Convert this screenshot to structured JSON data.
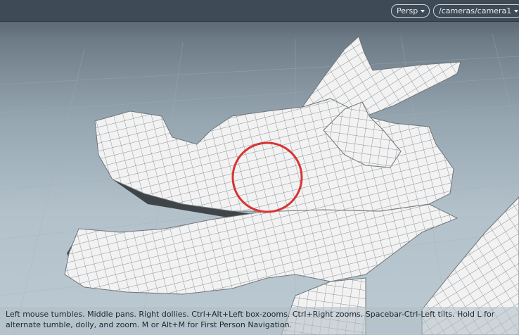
{
  "viewport": {
    "view_mode": "Persp",
    "camera": "/cameras/camera1",
    "help_text": "Left mouse tumbles. Middle pans. Right dollies. Ctrl+Alt+Left box-zooms. Ctrl+Right zooms. Spacebar-Ctrl-Left tilts. Hold L for alternate tumble, dolly, and zoom.     M or Alt+M for First Person Navigation.",
    "highlight_color": "#d83434",
    "mesh_fill": "#f2f2f2",
    "mesh_wire": "#8a8f93"
  }
}
